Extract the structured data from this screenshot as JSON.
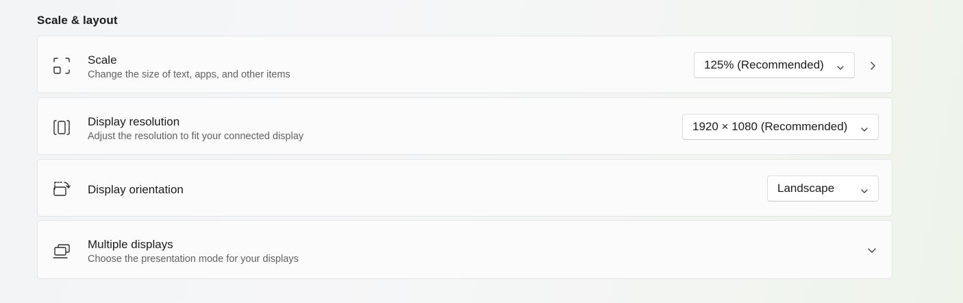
{
  "section": {
    "title": "Scale & layout"
  },
  "scale": {
    "title": "Scale",
    "subtitle": "Change the size of text, apps, and other items",
    "value": "125% (Recommended)",
    "icon": "scale-icon"
  },
  "resolution": {
    "title": "Display resolution",
    "subtitle": "Adjust the resolution to fit your connected display",
    "value": "1920 × 1080 (Recommended)",
    "icon": "resolution-icon"
  },
  "orientation": {
    "title": "Display orientation",
    "value": "Landscape",
    "icon": "orientation-icon"
  },
  "multiple": {
    "title": "Multiple displays",
    "subtitle": "Choose the presentation mode for your displays",
    "icon": "multiple-displays-icon"
  },
  "colors": {
    "card_background": "#fbfbfb",
    "card_border": "#e5e5e5",
    "subtitle_text": "#606060"
  }
}
